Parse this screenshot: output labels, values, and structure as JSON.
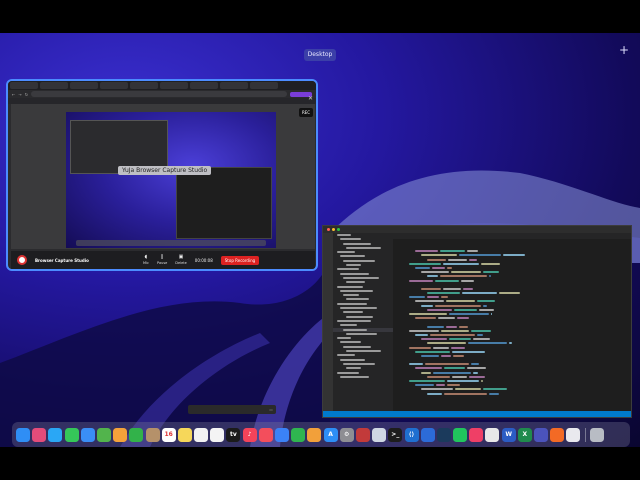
{
  "desktop": {
    "label": "Desktop",
    "add_space": "+"
  },
  "chrome": {
    "tabs": [
      "",
      "",
      "",
      "",
      "",
      "",
      "",
      "",
      ""
    ],
    "url": "",
    "capture_label": "YuJa Browser Capture Studio",
    "rec_badge": "REC",
    "app_name": "Browser Capture Studio",
    "controls": {
      "mic": "Mic",
      "pause": "Pause",
      "delete": "Delete"
    },
    "timer": "00:00:08",
    "stop": "Stop Recording",
    "close": "✕"
  },
  "vscode": {
    "explorer_rows": [
      "",
      "",
      "",
      "",
      "",
      "",
      "",
      "",
      "",
      "",
      "",
      "",
      "",
      "",
      "",
      "",
      "",
      "",
      "",
      "",
      "",
      "",
      "",
      "",
      "",
      "",
      "",
      "",
      "",
      "",
      "",
      "",
      "",
      ""
    ],
    "status": ""
  },
  "notification": {
    "text": "",
    "button": ""
  },
  "dock": {
    "icons": [
      {
        "name": "finder-icon",
        "color": "#2f8ef5",
        "glyph": ""
      },
      {
        "name": "launchpad-icon",
        "color": "#e44c7a",
        "glyph": ""
      },
      {
        "name": "safari-icon",
        "color": "#2aa7f5",
        "glyph": ""
      },
      {
        "name": "messages-icon",
        "color": "#35c759",
        "glyph": ""
      },
      {
        "name": "mail-icon",
        "color": "#3a8ef6",
        "glyph": ""
      },
      {
        "name": "maps-icon",
        "color": "#52b44c",
        "glyph": ""
      },
      {
        "name": "photos-icon",
        "color": "#f4a23a",
        "glyph": ""
      },
      {
        "name": "facetime-icon",
        "color": "#32b24a",
        "glyph": ""
      },
      {
        "name": "contacts-icon",
        "color": "#b5916a",
        "glyph": ""
      },
      {
        "name": "calendar-icon",
        "color": "#ffffff",
        "glyph": "16"
      },
      {
        "name": "notes-icon",
        "color": "#f6d75a",
        "glyph": ""
      },
      {
        "name": "reminders-icon",
        "color": "#f2f2f2",
        "glyph": ""
      },
      {
        "name": "freeform-icon",
        "color": "#f4f4f4",
        "glyph": ""
      },
      {
        "name": "tv-icon",
        "color": "#1b1b1b",
        "glyph": "tv"
      },
      {
        "name": "music-icon",
        "color": "#f3435a",
        "glyph": "♪"
      },
      {
        "name": "news-icon",
        "color": "#f34e5c",
        "glyph": ""
      },
      {
        "name": "keynote-icon",
        "color": "#3b82f6",
        "glyph": ""
      },
      {
        "name": "numbers-icon",
        "color": "#2fb550",
        "glyph": ""
      },
      {
        "name": "pages-icon",
        "color": "#f2a03a",
        "glyph": ""
      },
      {
        "name": "app-store-icon",
        "color": "#2d8ef6",
        "glyph": "A"
      },
      {
        "name": "system-settings-icon",
        "color": "#8e8e93",
        "glyph": "⚙"
      },
      {
        "name": "photo-booth-icon",
        "color": "#c23a3a",
        "glyph": ""
      },
      {
        "name": "preview-icon",
        "color": "#cfd7e3",
        "glyph": ""
      },
      {
        "name": "terminal-icon",
        "color": "#1d1d1d",
        "glyph": ">_"
      },
      {
        "name": "visual-studio-code-icon",
        "color": "#1f6fd0",
        "glyph": "⟨⟩"
      },
      {
        "name": "xcode-icon",
        "color": "#2c6bd8",
        "glyph": ""
      },
      {
        "name": "steam-icon",
        "color": "#1b3a5c",
        "glyph": ""
      },
      {
        "name": "pycharm-icon",
        "color": "#21c55d",
        "glyph": ""
      },
      {
        "name": "intellij-icon",
        "color": "#ef3f66",
        "glyph": ""
      },
      {
        "name": "chrome-icon",
        "color": "#e8e8e8",
        "glyph": ""
      },
      {
        "name": "word-icon",
        "color": "#2b5cc4",
        "glyph": "W"
      },
      {
        "name": "excel-icon",
        "color": "#1f8b4d",
        "glyph": "X"
      },
      {
        "name": "teams-icon",
        "color": "#4b53bc",
        "glyph": ""
      },
      {
        "name": "firefox-icon",
        "color": "#f36a25",
        "glyph": ""
      },
      {
        "name": "documents-icon",
        "color": "#e9e9ee",
        "glyph": ""
      },
      {
        "name": "trash-icon",
        "color": "#b8bcc4",
        "glyph": ""
      }
    ]
  },
  "colors": {
    "window_focus_border": "#4c8cff",
    "stop_button": "#dd2222",
    "vscode_status": "#007acc"
  }
}
